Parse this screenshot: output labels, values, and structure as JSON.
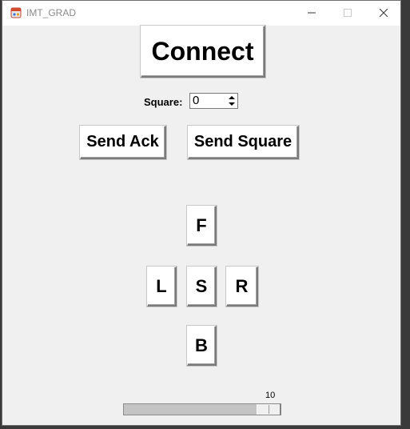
{
  "window": {
    "title": "IMT_GRAD",
    "controls": {
      "minimize": "minimize",
      "maximize": "maximize",
      "close": "close"
    }
  },
  "main": {
    "connect_label": "Connect",
    "square": {
      "label": "Square:",
      "value": "0"
    },
    "send_ack_label": "Send Ack",
    "send_square_label": "Send Square",
    "directions": {
      "forward": "F",
      "left": "L",
      "stop": "S",
      "right": "R",
      "back": "B"
    },
    "slider": {
      "value": "10",
      "min": 0,
      "max": 10,
      "fraction": 1.0
    }
  },
  "colors": {
    "background": "#f0f0f0",
    "titlebar": "#ffffff",
    "button": "#ffffff"
  },
  "icons": [
    "app-icon",
    "minimize-icon",
    "maximize-icon",
    "close-icon",
    "spin-up-icon",
    "spin-down-icon"
  ]
}
